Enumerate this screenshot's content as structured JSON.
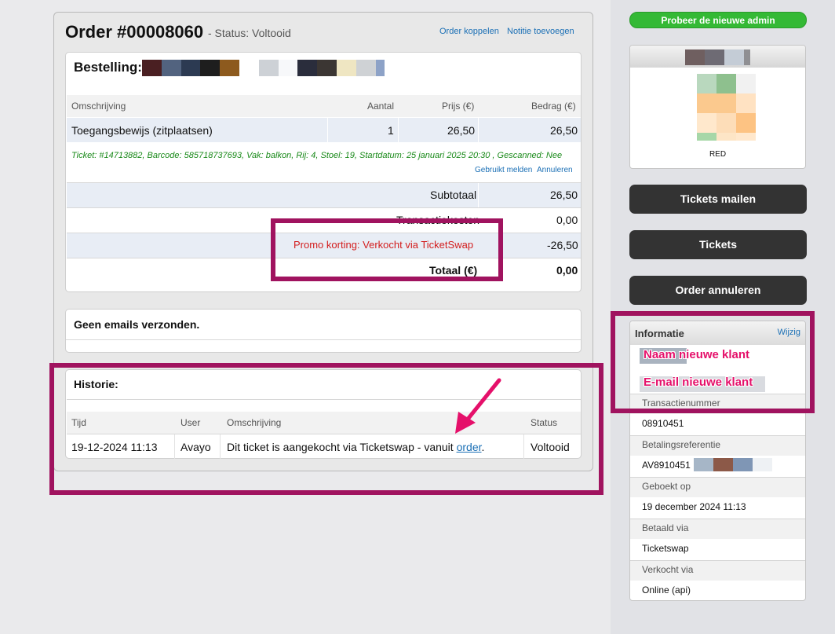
{
  "order": {
    "title": "Order #00008060",
    "status": "- Status: Voltooid",
    "link_koppelen": "Order koppelen",
    "link_notitie": "Notitie toevoegen"
  },
  "bestelling": {
    "title": "Bestelling:",
    "pixel_colors": [
      "#4a1f22",
      "#52637f",
      "#2c3a52",
      "#1e1e1e",
      "#8d5a1e",
      "#ffffff",
      "#cdd1d6",
      "#f7f8fa",
      "#2a2d3c",
      "#3b3633",
      "#efe6c2",
      "#cfd2d5",
      "#8da2c7"
    ],
    "columns": [
      "Omschrijving",
      "Aantal",
      "Prijs (€)",
      "Bedrag (€)"
    ],
    "item": {
      "desc": "Toegangsbewijs (zitplaatsen)",
      "qty": "1",
      "price": "26,50",
      "amount": "26,50"
    },
    "ticket_info": "Ticket: #14713882, Barcode: 585718737693, Vak: balkon, Rij: 4, Stoel: 19, Startdatum: 25 januari 2025 20:30 , Gescanned: Nee",
    "link_gebruikt": "Gebruikt melden",
    "link_annuleren": "Annuleren",
    "subtotaal_label": "Subtotaal",
    "subtotaal_value": "26,50",
    "transactie_label": "Transactiekosten",
    "transactie_value": "0,00",
    "promo_label": "Promo korting: Verkocht via TicketSwap",
    "promo_value": "-26,50",
    "totaal_label": "Totaal (€)",
    "totaal_value": "0,00"
  },
  "emails": {
    "title": "Geen emails verzonden."
  },
  "historie": {
    "title": "Historie:",
    "columns": [
      "Tijd",
      "User",
      "Omschrijving",
      "Status"
    ],
    "row": {
      "time": "19-12-2024 11:13",
      "user": "Avayo",
      "desc": "Dit ticket is aangekocht via Ticketswap - vanuit ",
      "link": "order",
      "desc_end": ".",
      "status": "Voltooid"
    }
  },
  "sidebar": {
    "admin_button": "Probeer de nieuwe admin",
    "widget_label": "RED",
    "widget_header_colors": [
      "#6f5f60",
      "#6e6b74",
      "#c4ccd6",
      "#8f8f93"
    ],
    "widget_grid_colors": [
      "#b9d8be",
      "#8ec08e",
      "#f1f1f1",
      "#fbc98e",
      "#fbc98e",
      "#ffe2c2",
      "#ffe8cc",
      "#fdddb8",
      "#fdc383",
      "#a7d7a8",
      "#fde5c6",
      "#ffe8cd"
    ],
    "btn_mailen": "Tickets mailen",
    "btn_tickets": "Tickets",
    "btn_annuleren": "Order annuleren",
    "info": {
      "title": "Informatie",
      "wijzig": "Wijzig",
      "naam_overlay": "Naam nieuwe klant",
      "email_overlay": "E-mail nieuwe klant",
      "transactie_label": "Transactienummer",
      "transactie_value": "08910451",
      "betaling_label": "Betalingsreferentie",
      "betaling_value": "AV8910451",
      "betaling_pixel_colors": [
        "#a6b6c7",
        "#8c5948",
        "#7f96b5",
        "#eef1f4"
      ],
      "geboekt_label": "Geboekt op",
      "geboekt_value": "19 december 2024 11:13",
      "betaald_label": "Betaald via",
      "betaald_value": "Ticketswap",
      "verkocht_label": "Verkocht via",
      "verkocht_value": "Online (api)"
    }
  },
  "annotations": {
    "highlight_color": "#a0135f",
    "arrow_color": "#e5106a"
  }
}
